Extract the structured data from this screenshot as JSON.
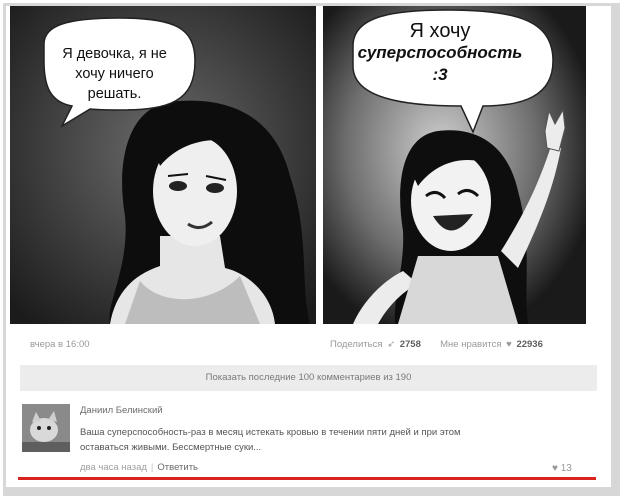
{
  "comic": {
    "panel1_speech": [
      "Я девочка, я не",
      "хочу ничего",
      "решать."
    ],
    "panel2_speech": [
      "Я хочу",
      "суперспособность",
      ":3"
    ]
  },
  "post": {
    "date": "вчера в 16:00",
    "share_label": "Поделиться",
    "share_count": "2758",
    "likes_label": "Мне нравится",
    "likes_count": "22936",
    "show_comments": "Показать последние 100 комментариев из 190"
  },
  "comment": {
    "author": "Даниил Белинский",
    "text_line1": "Ваша суперспособность-раз в месяц истекать кровью в течении пяти дней и при этом",
    "text_line2": "оставаться живыми. Бессмертные суки...",
    "time": "два часа назад",
    "separator": "|",
    "reply": "Ответить",
    "likes": "13"
  },
  "colors": {
    "highlight_underline": "#d8231f",
    "frame": "#d7d7d7"
  },
  "icons": [
    "share-icon",
    "heart-icon"
  ]
}
